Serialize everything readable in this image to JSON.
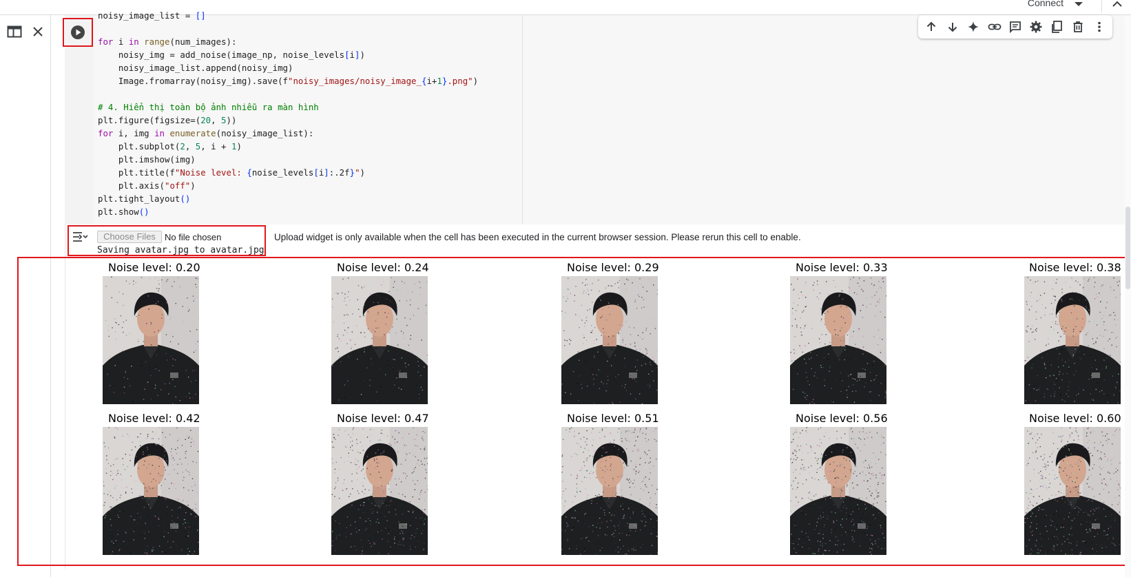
{
  "header": {
    "connect_label": "Connect"
  },
  "cell": {
    "code_lines": [
      [
        {
          "t": "noisy_image_list = "
        },
        {
          "t": "[]",
          "c": "br"
        }
      ],
      [],
      [
        {
          "t": "for",
          "c": "kw"
        },
        {
          "t": " i "
        },
        {
          "t": "in",
          "c": "kw"
        },
        {
          "t": " "
        },
        {
          "t": "range",
          "c": "bi"
        },
        {
          "t": "(num_images):"
        }
      ],
      [
        {
          "t": "    noisy_img = add_noise(image_np, noise_levels"
        },
        {
          "t": "[",
          "c": "br"
        },
        {
          "t": "i"
        },
        {
          "t": "]",
          "c": "br"
        },
        {
          "t": ")"
        }
      ],
      [
        {
          "t": "    noisy_image_list.append(noisy_img)"
        }
      ],
      [
        {
          "t": "    Image.fromarray(noisy_img).save(f"
        },
        {
          "t": "\"noisy_images/noisy_image_",
          "c": "str"
        },
        {
          "t": "{",
          "c": "br"
        },
        {
          "t": "i+"
        },
        {
          "t": "1",
          "c": "num"
        },
        {
          "t": "}",
          "c": "br"
        },
        {
          "t": ".png\"",
          "c": "str"
        },
        {
          "t": ")"
        }
      ],
      [],
      [
        {
          "t": "# 4. Hiển thị toàn bộ ảnh nhiễu ra màn hình",
          "c": "cm"
        }
      ],
      [
        {
          "t": "plt.figure(figsize=("
        },
        {
          "t": "20",
          "c": "num"
        },
        {
          "t": ", "
        },
        {
          "t": "5",
          "c": "num"
        },
        {
          "t": "))"
        }
      ],
      [
        {
          "t": "for",
          "c": "kw"
        },
        {
          "t": " i, img "
        },
        {
          "t": "in",
          "c": "kw"
        },
        {
          "t": " "
        },
        {
          "t": "enumerate",
          "c": "bi"
        },
        {
          "t": "(noisy_image_list):"
        }
      ],
      [
        {
          "t": "    plt.subplot("
        },
        {
          "t": "2",
          "c": "num"
        },
        {
          "t": ", "
        },
        {
          "t": "5",
          "c": "num"
        },
        {
          "t": ", i + "
        },
        {
          "t": "1",
          "c": "num"
        },
        {
          "t": ")"
        }
      ],
      [
        {
          "t": "    plt.imshow(img)"
        }
      ],
      [
        {
          "t": "    plt.title(f"
        },
        {
          "t": "\"Noise level: ",
          "c": "str"
        },
        {
          "t": "{",
          "c": "br"
        },
        {
          "t": "noise_levels"
        },
        {
          "t": "[",
          "c": "br"
        },
        {
          "t": "i"
        },
        {
          "t": "]",
          "c": "br"
        },
        {
          "t": ":.2f"
        },
        {
          "t": "}",
          "c": "br"
        },
        {
          "t": "\"",
          "c": "str"
        },
        {
          "t": ")"
        }
      ],
      [
        {
          "t": "    plt.axis("
        },
        {
          "t": "\"off\"",
          "c": "str"
        },
        {
          "t": ")"
        }
      ],
      [
        {
          "t": "plt.tight_layout"
        },
        {
          "t": "()",
          "c": "br"
        }
      ],
      [
        {
          "t": "plt.show"
        },
        {
          "t": "()",
          "c": "br"
        }
      ]
    ]
  },
  "output": {
    "choose_files_label": "Choose Files",
    "no_file_label": "No file chosen",
    "saving_text": "Saving avatar.jpg to avatar.jpg",
    "upload_message": "Upload widget is only available when the cell has been executed in the current browser session. Please rerun this cell to enable.",
    "plot_titles": [
      "Noise level: 0.20",
      "Noise level: 0.24",
      "Noise level: 0.29",
      "Noise level: 0.33",
      "Noise level: 0.38",
      "Noise level: 0.42",
      "Noise level: 0.47",
      "Noise level: 0.51",
      "Noise level: 0.56",
      "Noise level: 0.60"
    ],
    "noise_levels": [
      0.2,
      0.24,
      0.29,
      0.33,
      0.38,
      0.42,
      0.47,
      0.51,
      0.56,
      0.6
    ]
  },
  "toolbar_icons": [
    "arrow-up-icon",
    "arrow-down-icon",
    "sparkle-icon",
    "link-icon",
    "comment-icon",
    "gear-icon",
    "mirror-cell-icon",
    "trash-icon",
    "more-vert-icon"
  ],
  "colors": {
    "highlight_red": "#e0161b",
    "keyword": "#9a0ea8",
    "string": "#a31515",
    "comment": "#008000",
    "number": "#098658"
  }
}
